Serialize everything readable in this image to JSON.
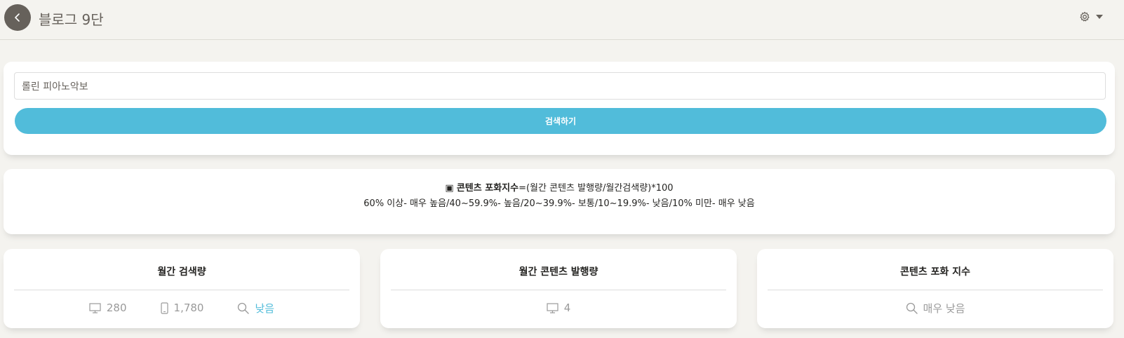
{
  "header": {
    "title": "블로그 9단",
    "back_icon": "chevron-left-icon",
    "settings_icon": "gear-icon"
  },
  "search": {
    "value": "롤린 피아노악보",
    "button_label": "검색하기"
  },
  "info": {
    "bullet": "▣",
    "formula_bold": "콘텐츠 포화지수",
    "formula_rest": "=(월간 콘텐츠 발행량/월간검색량)*100",
    "scale": "60% 이상- 매우 높음/40~59.9%- 높음/20~39.9%- 보통/10~19.9%- 낮음/10% 미만- 매우 낮음"
  },
  "stats": {
    "monthly_search": {
      "title": "월간 검색량",
      "pc": "280",
      "mobile": "1,780",
      "level": "낮음"
    },
    "monthly_content": {
      "title": "월간 콘텐츠 발행량",
      "pc": "4"
    },
    "saturation": {
      "title": "콘텐츠 포화 지수",
      "level": "매우 낮음"
    }
  },
  "colors": {
    "accent": "#51bcda",
    "header_button": "#66615b",
    "background": "#f4f3ef"
  }
}
